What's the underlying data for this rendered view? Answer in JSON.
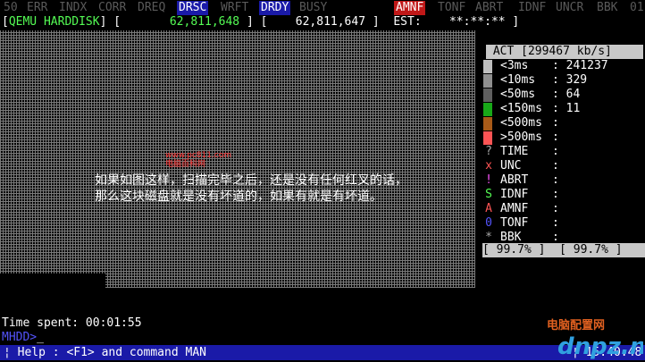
{
  "registers": [
    {
      "label": "50",
      "state": "off"
    },
    {
      "label": "ERR",
      "state": "off"
    },
    {
      "label": "INDX",
      "state": "off"
    },
    {
      "label": "CORR",
      "state": "off"
    },
    {
      "label": "DREQ",
      "state": "off"
    },
    {
      "label": "DRSC",
      "state": "on"
    },
    {
      "label": "WRFT",
      "state": "off"
    },
    {
      "label": "DRDY",
      "state": "on"
    },
    {
      "label": "BUSY",
      "state": "off"
    },
    {
      "label": "AMNF",
      "state": "red"
    },
    {
      "label": "TONF",
      "state": "off"
    },
    {
      "label": "ABRT",
      "state": "off"
    },
    {
      "label": "IDNF",
      "state": "off"
    },
    {
      "label": "UNCR",
      "state": "off"
    },
    {
      "label": "BBK",
      "state": "off"
    },
    {
      "label": "01",
      "state": "off"
    }
  ],
  "drive": {
    "name": "QEMU HARDDISK",
    "lba_current": "62,811,648",
    "lba_total": "62,811,647",
    "est_label": "EST:",
    "est_value": "**:**:**"
  },
  "speed": {
    "label": "ACT [299467 kb/s]"
  },
  "buckets": [
    {
      "label": "<3ms",
      "value": "241237",
      "color": "#bfbfbf"
    },
    {
      "label": "<10ms",
      "value": "329",
      "color": "#8f8f8f"
    },
    {
      "label": "<50ms",
      "value": "64",
      "color": "#5f5f5f"
    },
    {
      "label": "<150ms",
      "value": "11",
      "color": "#18a818"
    },
    {
      "label": "<500ms",
      "value": "",
      "color": "#a85a18"
    },
    {
      "label": ">500ms",
      "value": "",
      "color": "#fc5454"
    }
  ],
  "errors": [
    {
      "sym": "?",
      "label": "TIME",
      "value": "",
      "color": "#a8a8a8"
    },
    {
      "sym": "x",
      "label": "UNC",
      "value": "",
      "color": "#fc5454"
    },
    {
      "sym": "!",
      "label": "ABRT",
      "value": "",
      "color": "#fc54fc"
    },
    {
      "sym": "S",
      "label": "IDNF",
      "value": "",
      "color": "#54fc54"
    },
    {
      "sym": "A",
      "label": "AMNF",
      "value": "",
      "color": "#fc5454"
    },
    {
      "sym": "0",
      "label": "TONF",
      "value": "",
      "color": "#5454fc"
    },
    {
      "sym": "*",
      "label": "BBK",
      "value": "",
      "color": "#a8a8a8"
    }
  ],
  "progress": {
    "left": "99.7%",
    "right": "99.7%"
  },
  "time_spent": {
    "label": "Time spent:",
    "value": "00:01:55"
  },
  "prompt": "MHDD>",
  "overlay": {
    "line1": "如果如图这样，扫描完毕之后，还是没有任何红叉的话，",
    "line2": "那么这块磁盘就是没有坏道的，如果有就是有坏道。",
    "wm_url": "www.pc811.com",
    "wm_name": "电脑百科网"
  },
  "help": {
    "text": "¦ Help : <F1> and command MAN",
    "time": "¦ 15:40:48"
  },
  "watermark": {
    "big": "dnpz.net",
    "small": "电脑配置网"
  }
}
